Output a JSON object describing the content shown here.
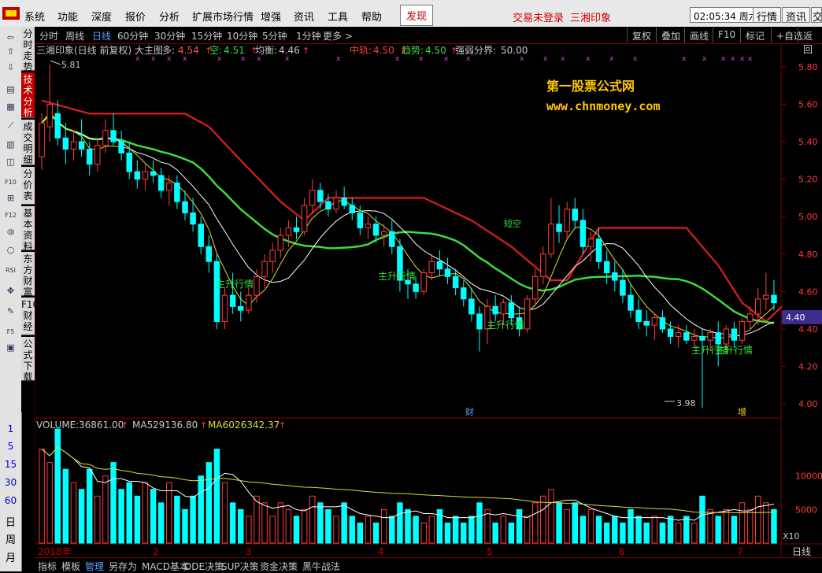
{
  "menu": {
    "items": [
      "系统",
      "功能",
      "深度",
      "报价",
      "分析",
      "扩展市场行情",
      "增强",
      "资讯",
      "工具",
      "帮助"
    ],
    "active": "发现",
    "trade_status": "交易未登录",
    "stock_name": "三湘印象",
    "time": "02:05:34",
    "weekday": "周六",
    "right_buttons": [
      "行情",
      "资讯",
      "交"
    ]
  },
  "left_toolbar": {
    "icons": [
      "back-icon",
      "up-icon",
      "down-icon",
      "stock-list-icon",
      "quote-table-icon",
      "line-chart-icon",
      "kline-icon",
      "chart-icon",
      "f10-icon",
      "money-icon",
      "f11-icon",
      "fund-icon",
      "circle-icon",
      "rsi-icon",
      "move-icon",
      "pencil-icon",
      "f5-icon",
      "image-icon"
    ],
    "icon_texts": [
      "⇦",
      "⇧",
      "⇩",
      "▤",
      "▦",
      "⟋",
      "▥",
      "◫",
      "F10",
      "⊞",
      "F12",
      "⑩",
      "○",
      "RSI",
      "✥",
      "✎",
      "F5",
      "▣"
    ],
    "periods": [
      "1",
      "5",
      "15",
      "30",
      "60"
    ],
    "cycles": [
      "日",
      "周",
      "月"
    ]
  },
  "vertical_tabs": [
    {
      "label": "分时走势",
      "active": false
    },
    {
      "label": "技术分析",
      "active": true
    },
    {
      "label": "成交明细",
      "active": false
    },
    {
      "label": "分价表",
      "active": false
    },
    {
      "label": "基本资料",
      "active": false
    },
    {
      "label": "东方财富",
      "active": false
    },
    {
      "label": "F10财经",
      "active": false
    },
    {
      "label": "公式下载",
      "active": false
    }
  ],
  "period_bar": {
    "periods": [
      "分时",
      "周线",
      "日线",
      "60分钟",
      "30分钟",
      "15分钟",
      "10分钟",
      "5分钟",
      "1分钟",
      "更多 >"
    ],
    "active_index": 2,
    "right_buttons": [
      "复权",
      "叠加",
      "画线",
      "F10",
      "标记",
      "+自选",
      "返回"
    ]
  },
  "main_header": {
    "title": "三湘印象(日线 前复权) 大主图",
    "duo_label": "多:",
    "duo_value": "4.54",
    "kong_label": "空:",
    "kong_value": "4.51",
    "junheng_label": "均衡:",
    "junheng_value": "4.46",
    "zhonggui_label": "中轨:",
    "zhonggui_value": "4.50",
    "qushi_label": "趋势:",
    "qushi_value": "4.50",
    "qiangruo_label": "强弱分界:",
    "qiangruo_value": "50.00"
  },
  "volume_header": {
    "volume_label": "VOLUME:",
    "volume_value": "36861.00",
    "ma5_label": "MA5:",
    "ma5_value": "29136.80",
    "ma60_label": "MA60:",
    "ma60_value": "26342.37"
  },
  "watermark": {
    "cn": "第一股票公式网",
    "url": "www.chnmoney.com"
  },
  "annotations": {
    "high": "5.81",
    "low": "3.98",
    "signal": "主升行情",
    "duankong": "短空",
    "cai": "财",
    "zeng": "增",
    "current_price": "4.40"
  },
  "axes": {
    "price_ticks": [
      "5.80",
      "5.60",
      "5.40",
      "5.20",
      "5.00",
      "4.80",
      "4.60",
      "4.40",
      "4.20",
      "4.00"
    ],
    "volume_ticks": [
      "10000",
      "5000"
    ],
    "volume_unit": "X10",
    "date_labels": [
      "2018年",
      "2",
      "3",
      "4",
      "5",
      "6",
      "7"
    ],
    "cycle_label": "日线"
  },
  "bottom_tabs": [
    "指标",
    "模板",
    "管理",
    "另存为",
    "MACD基本",
    "DDE决策",
    "SUP决策",
    "资金决策",
    "黑牛战法"
  ],
  "bottom_active": 2,
  "colors": {
    "up": "#ff3c3c",
    "down": "#00ffff",
    "green_line": "#3cdc3c",
    "red_line": "#dc1e1e",
    "ma_white": "#ffffff",
    "watermark": "#ffc800"
  },
  "chart_data": {
    "type": "candlestick",
    "ylim": [
      3.95,
      5.85
    ],
    "candles_ohlc": [
      [
        5.32,
        5.55,
        5.25,
        5.5
      ],
      [
        5.48,
        5.81,
        5.4,
        5.6
      ],
      [
        5.55,
        5.62,
        5.38,
        5.42
      ],
      [
        5.42,
        5.5,
        5.28,
        5.36
      ],
      [
        5.36,
        5.46,
        5.3,
        5.4
      ],
      [
        5.4,
        5.52,
        5.32,
        5.36
      ],
      [
        5.36,
        5.4,
        5.22,
        5.28
      ],
      [
        5.28,
        5.42,
        5.24,
        5.38
      ],
      [
        5.38,
        5.52,
        5.34,
        5.46
      ],
      [
        5.46,
        5.55,
        5.38,
        5.4
      ],
      [
        5.4,
        5.46,
        5.3,
        5.34
      ],
      [
        5.34,
        5.4,
        5.2,
        5.24
      ],
      [
        5.24,
        5.3,
        5.15,
        5.2
      ],
      [
        5.2,
        5.28,
        5.14,
        5.24
      ],
      [
        5.24,
        5.3,
        5.18,
        5.22
      ],
      [
        5.22,
        5.26,
        5.1,
        5.14
      ],
      [
        5.14,
        5.22,
        5.06,
        5.18
      ],
      [
        5.18,
        5.22,
        5.04,
        5.08
      ],
      [
        5.08,
        5.14,
        4.98,
        5.02
      ],
      [
        5.02,
        5.1,
        4.92,
        4.96
      ],
      [
        4.96,
        5.0,
        4.8,
        4.84
      ],
      [
        4.84,
        4.9,
        4.7,
        4.76
      ],
      [
        4.76,
        4.8,
        4.4,
        4.44
      ],
      [
        4.44,
        4.62,
        4.4,
        4.58
      ],
      [
        4.58,
        4.7,
        4.48,
        4.52
      ],
      [
        4.52,
        4.6,
        4.44,
        4.5
      ],
      [
        4.5,
        4.62,
        4.48,
        4.58
      ],
      [
        4.58,
        4.72,
        4.54,
        4.68
      ],
      [
        4.68,
        4.8,
        4.62,
        4.76
      ],
      [
        4.76,
        4.86,
        4.7,
        4.82
      ],
      [
        4.82,
        4.94,
        4.78,
        4.9
      ],
      [
        4.9,
        4.98,
        4.84,
        4.94
      ],
      [
        4.94,
        5.0,
        4.88,
        4.92
      ],
      [
        4.92,
        5.1,
        4.9,
        5.06
      ],
      [
        5.06,
        5.2,
        5.02,
        5.14
      ],
      [
        5.14,
        5.18,
        5.04,
        5.08
      ],
      [
        5.08,
        5.12,
        5.0,
        5.04
      ],
      [
        5.04,
        5.14,
        5.02,
        5.1
      ],
      [
        5.1,
        5.16,
        5.04,
        5.06
      ],
      [
        5.06,
        5.1,
        4.98,
        5.02
      ],
      [
        5.02,
        5.06,
        4.9,
        4.94
      ],
      [
        4.94,
        5.0,
        4.88,
        4.96
      ],
      [
        4.96,
        5.0,
        4.86,
        4.9
      ],
      [
        4.9,
        4.96,
        4.84,
        4.92
      ],
      [
        4.92,
        4.98,
        4.8,
        4.84
      ],
      [
        4.84,
        4.88,
        4.6,
        4.66
      ],
      [
        4.66,
        4.72,
        4.56,
        4.64
      ],
      [
        4.64,
        4.68,
        4.56,
        4.6
      ],
      [
        4.6,
        4.72,
        4.58,
        4.7
      ],
      [
        4.7,
        4.8,
        4.66,
        4.76
      ],
      [
        4.76,
        4.82,
        4.68,
        4.72
      ],
      [
        4.72,
        4.78,
        4.64,
        4.68
      ],
      [
        4.68,
        4.72,
        4.58,
        4.62
      ],
      [
        4.62,
        4.66,
        4.52,
        4.56
      ],
      [
        4.56,
        4.62,
        4.44,
        4.48
      ],
      [
        4.48,
        4.52,
        4.28,
        4.4
      ],
      [
        4.4,
        4.56,
        4.32,
        4.52
      ],
      [
        4.52,
        4.58,
        4.44,
        4.48
      ],
      [
        4.48,
        4.56,
        4.42,
        4.54
      ],
      [
        4.54,
        4.58,
        4.42,
        4.46
      ],
      [
        4.46,
        4.52,
        4.36,
        4.4
      ],
      [
        4.4,
        4.58,
        4.38,
        4.56
      ],
      [
        4.56,
        4.72,
        4.52,
        4.68
      ],
      [
        4.68,
        4.84,
        4.64,
        4.8
      ],
      [
        4.8,
        5.1,
        4.78,
        4.96
      ],
      [
        4.96,
        5.06,
        4.86,
        4.92
      ],
      [
        4.92,
        5.08,
        4.88,
        5.04
      ],
      [
        5.04,
        5.1,
        4.94,
        4.98
      ],
      [
        4.98,
        5.04,
        4.8,
        4.84
      ],
      [
        4.84,
        4.92,
        4.76,
        4.88
      ],
      [
        4.88,
        4.94,
        4.72,
        4.76
      ],
      [
        4.76,
        4.82,
        4.64,
        4.7
      ],
      [
        4.7,
        4.76,
        4.6,
        4.66
      ],
      [
        4.66,
        4.72,
        4.54,
        4.58
      ],
      [
        4.58,
        4.64,
        4.46,
        4.5
      ],
      [
        4.5,
        4.56,
        4.4,
        4.44
      ],
      [
        4.44,
        4.5,
        4.36,
        4.42
      ],
      [
        4.42,
        4.48,
        4.34,
        4.46
      ],
      [
        4.46,
        4.5,
        4.38,
        4.4
      ],
      [
        4.4,
        4.44,
        4.32,
        4.36
      ],
      [
        4.36,
        4.42,
        4.3,
        4.38
      ],
      [
        4.38,
        4.42,
        4.32,
        4.34
      ],
      [
        4.34,
        4.4,
        4.3,
        4.36
      ],
      [
        4.36,
        4.4,
        3.98,
        4.34
      ],
      [
        4.34,
        4.4,
        4.28,
        4.38
      ],
      [
        4.38,
        4.44,
        4.2,
        4.32
      ],
      [
        4.32,
        4.42,
        4.28,
        4.4
      ],
      [
        4.4,
        4.44,
        4.3,
        4.34
      ],
      [
        4.34,
        4.46,
        4.32,
        4.44
      ],
      [
        4.44,
        4.52,
        4.4,
        4.48
      ],
      [
        4.48,
        4.62,
        4.42,
        4.56
      ],
      [
        4.56,
        4.7,
        4.5,
        4.58
      ],
      [
        4.58,
        4.66,
        4.5,
        4.54
      ]
    ],
    "volume_values": [
      14000,
      12000,
      17000,
      11000,
      9000,
      8000,
      11000,
      7000,
      10000,
      12000,
      8000,
      9000,
      7000,
      9000,
      8000,
      6000,
      9000,
      7000,
      5000,
      7000,
      10000,
      12000,
      14000,
      9000,
      6000,
      5000,
      4000,
      7000,
      6000,
      4000,
      6000,
      5000,
      4000,
      5000,
      7000,
      6000,
      5000,
      4000,
      6000,
      4000,
      3000,
      4000,
      3000,
      5000,
      4000,
      6000,
      5000,
      4000,
      3000,
      4000,
      5000,
      3000,
      4000,
      3000,
      4000,
      6000,
      5000,
      3000,
      4000,
      3000,
      5000,
      4000,
      6000,
      7000,
      8000,
      6000,
      5000,
      6000,
      4000,
      5000,
      4000,
      3000,
      4000,
      3000,
      5000,
      4000,
      3000,
      4000,
      3000,
      4000,
      3000,
      4000,
      3000,
      7000,
      5000,
      4000,
      5000,
      4000,
      6000,
      5000,
      7000,
      6000,
      5000
    ]
  }
}
